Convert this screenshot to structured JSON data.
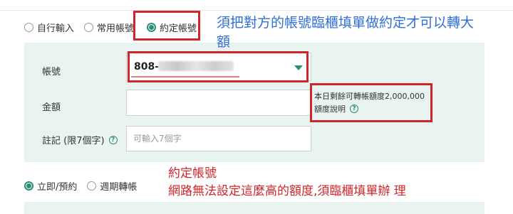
{
  "transfer_type_options": [
    {
      "label": "自行輸入",
      "selected": false
    },
    {
      "label": "常用帳號",
      "selected": false
    },
    {
      "label": "約定帳號",
      "selected": true
    }
  ],
  "form": {
    "account_label": "帳號",
    "account_value_visible": "808-",
    "amount_label": "金額",
    "limit_text": "本日剩餘可轉帳額度2,000,000",
    "limit_help": "額度說明",
    "note_label": "註記 (限7個字)",
    "note_placeholder": "可輸入7個字"
  },
  "timing_options": [
    {
      "label": "立即/預約",
      "selected": true
    },
    {
      "label": "週期轉帳",
      "selected": false
    }
  ],
  "annotations": {
    "blue_line1": "須把對方的帳號臨櫃填單做約定才可以轉大",
    "blue_line2": "額",
    "red_line1": "約定帳號",
    "red_line2": "網路無法設定這麼高的額度,須臨櫃填單辦 理"
  },
  "colors": {
    "accent": "#2a8f78",
    "highlight": "#d0262b",
    "annotation_blue": "#2f6fd6",
    "panel_bg": "#e9f4f1"
  },
  "icons": [
    "help-circle-icon",
    "dropdown-caret-icon"
  ]
}
